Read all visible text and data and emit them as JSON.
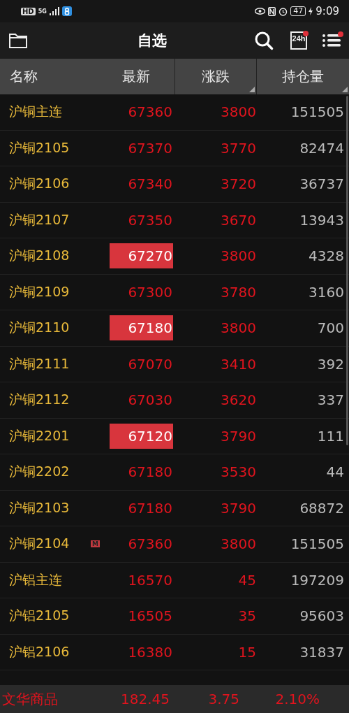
{
  "status_bar": {
    "hd": "HD",
    "network": "5G",
    "battery": "47",
    "time": "9:09"
  },
  "header": {
    "title": "自选",
    "news_label": "24h",
    "news_badge": true,
    "menu_badge": true
  },
  "table": {
    "columns": [
      {
        "label": "名称",
        "sortable": false
      },
      {
        "label": "最新",
        "sortable": false
      },
      {
        "label": "涨跌",
        "sortable": true
      },
      {
        "label": "持仓量",
        "sortable": true
      }
    ],
    "rows": [
      {
        "name": "沪铜主连",
        "price": "67360",
        "change": "3800",
        "open_interest": "151505",
        "highlighted": false
      },
      {
        "name": "沪铜2105",
        "price": "67370",
        "change": "3770",
        "open_interest": "82474",
        "highlighted": false
      },
      {
        "name": "沪铜2106",
        "price": "67340",
        "change": "3720",
        "open_interest": "36737",
        "highlighted": false
      },
      {
        "name": "沪铜2107",
        "price": "67350",
        "change": "3670",
        "open_interest": "13943",
        "highlighted": false
      },
      {
        "name": "沪铜2108",
        "price": "67270",
        "change": "3800",
        "open_interest": "4328",
        "highlighted": true
      },
      {
        "name": "沪铜2109",
        "price": "67300",
        "change": "3780",
        "open_interest": "3160",
        "highlighted": false
      },
      {
        "name": "沪铜2110",
        "price": "67180",
        "change": "3800",
        "open_interest": "700",
        "highlighted": true
      },
      {
        "name": "沪铜2111",
        "price": "67070",
        "change": "3410",
        "open_interest": "392",
        "highlighted": false
      },
      {
        "name": "沪铜2112",
        "price": "67030",
        "change": "3620",
        "open_interest": "337",
        "highlighted": false
      },
      {
        "name": "沪铜2201",
        "price": "67120",
        "change": "3790",
        "open_interest": "111",
        "highlighted": true
      },
      {
        "name": "沪铜2202",
        "price": "67180",
        "change": "3530",
        "open_interest": "44",
        "highlighted": false
      },
      {
        "name": "沪铜2103",
        "price": "67180",
        "change": "3790",
        "open_interest": "68872",
        "highlighted": false
      },
      {
        "name": "沪铜2104",
        "price": "67360",
        "change": "3800",
        "open_interest": "151505",
        "highlighted": false,
        "tag": "M"
      },
      {
        "name": "沪铝主连",
        "price": "16570",
        "change": "45",
        "open_interest": "197209",
        "highlighted": false
      },
      {
        "name": "沪铝2105",
        "price": "16505",
        "change": "35",
        "open_interest": "95603",
        "highlighted": false
      },
      {
        "name": "沪铝2106",
        "price": "16380",
        "change": "15",
        "open_interest": "31837",
        "highlighted": false
      }
    ]
  },
  "index_bar": {
    "name": "文华商品",
    "value": "182.45",
    "change": "3.75",
    "percent": "2.10%"
  }
}
